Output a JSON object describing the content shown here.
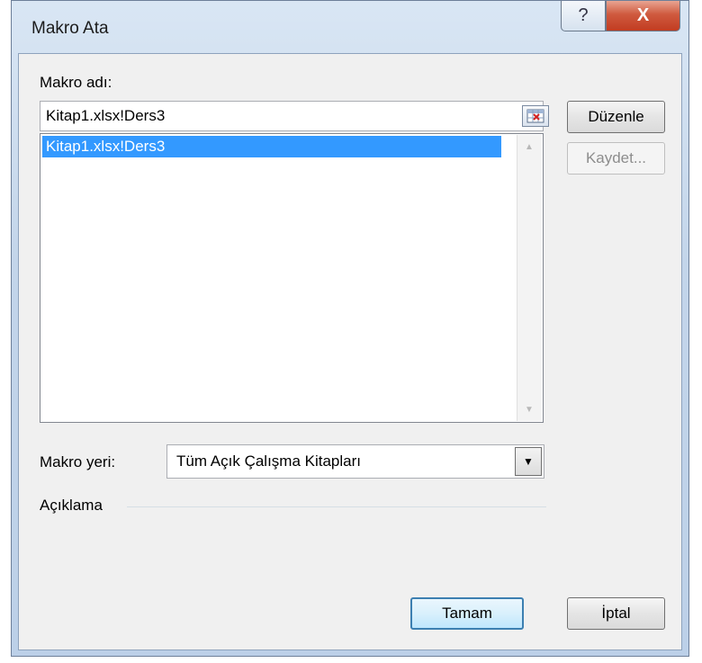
{
  "dialog": {
    "title": "Makro Ata",
    "help_glyph": "?",
    "close_glyph": "X"
  },
  "macro_name": {
    "label": "Makro adı:",
    "value": "Kitap1.xlsx!Ders3"
  },
  "macro_list": {
    "items": [
      "Kitap1.xlsx!Ders3"
    ],
    "selected_index": 0
  },
  "buttons": {
    "edit": "Düzenle",
    "record": "Kaydet...",
    "ok": "Tamam",
    "cancel": "İptal"
  },
  "macro_location": {
    "label": "Makro yeri:",
    "value": "Tüm Açık Çalışma Kitapları"
  },
  "description": {
    "label": "Açıklama"
  },
  "colors": {
    "selection": "#3399ff",
    "close_button": "#c23c21"
  }
}
